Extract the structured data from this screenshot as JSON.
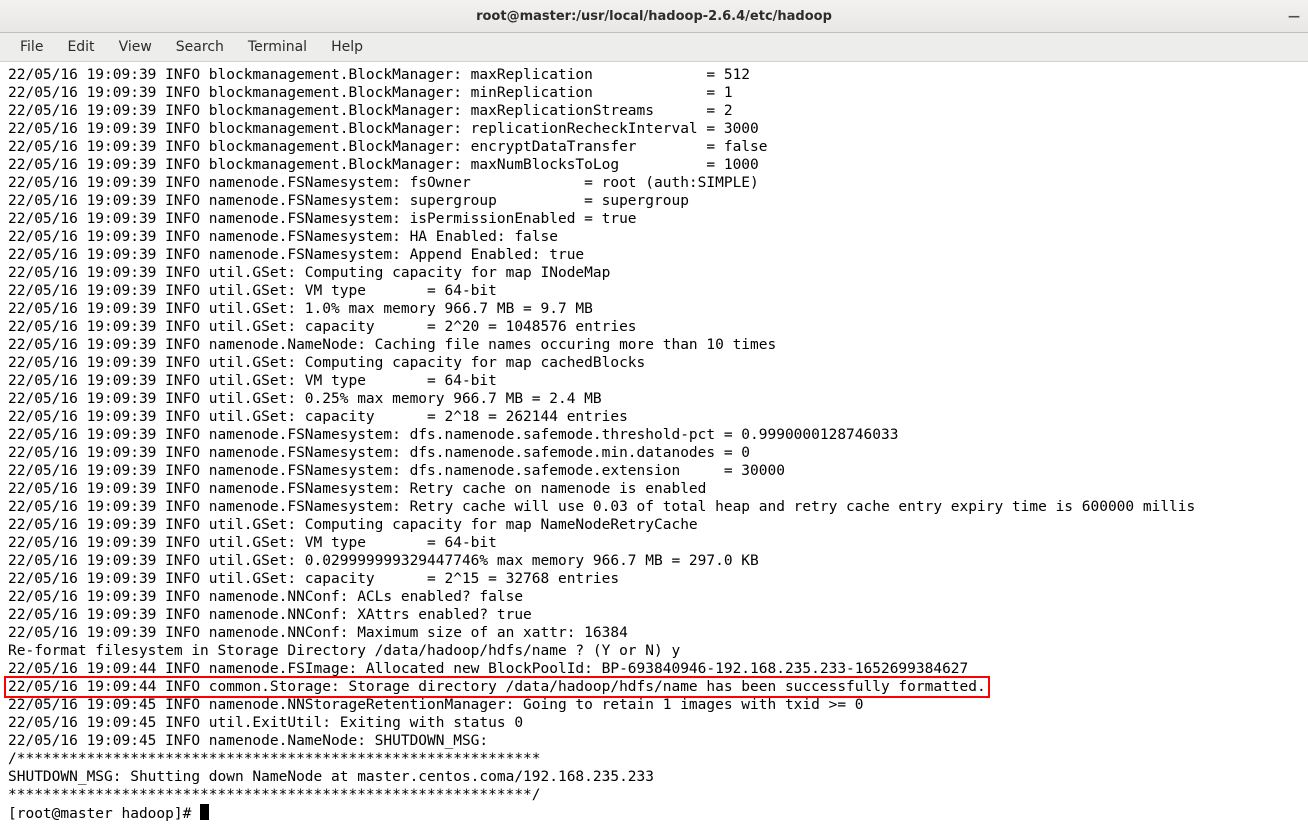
{
  "window": {
    "title": "root@master:/usr/local/hadoop-2.6.4/etc/hadoop"
  },
  "menubar": {
    "items": [
      "File",
      "Edit",
      "View",
      "Search",
      "Terminal",
      "Help"
    ]
  },
  "terminal": {
    "lines": [
      "22/05/16 19:09:39 INFO blockmanagement.BlockManager: maxReplication             = 512",
      "22/05/16 19:09:39 INFO blockmanagement.BlockManager: minReplication             = 1",
      "22/05/16 19:09:39 INFO blockmanagement.BlockManager: maxReplicationStreams      = 2",
      "22/05/16 19:09:39 INFO blockmanagement.BlockManager: replicationRecheckInterval = 3000",
      "22/05/16 19:09:39 INFO blockmanagement.BlockManager: encryptDataTransfer        = false",
      "22/05/16 19:09:39 INFO blockmanagement.BlockManager: maxNumBlocksToLog          = 1000",
      "22/05/16 19:09:39 INFO namenode.FSNamesystem: fsOwner             = root (auth:SIMPLE)",
      "22/05/16 19:09:39 INFO namenode.FSNamesystem: supergroup          = supergroup",
      "22/05/16 19:09:39 INFO namenode.FSNamesystem: isPermissionEnabled = true",
      "22/05/16 19:09:39 INFO namenode.FSNamesystem: HA Enabled: false",
      "22/05/16 19:09:39 INFO namenode.FSNamesystem: Append Enabled: true",
      "22/05/16 19:09:39 INFO util.GSet: Computing capacity for map INodeMap",
      "22/05/16 19:09:39 INFO util.GSet: VM type       = 64-bit",
      "22/05/16 19:09:39 INFO util.GSet: 1.0% max memory 966.7 MB = 9.7 MB",
      "22/05/16 19:09:39 INFO util.GSet: capacity      = 2^20 = 1048576 entries",
      "22/05/16 19:09:39 INFO namenode.NameNode: Caching file names occuring more than 10 times",
      "22/05/16 19:09:39 INFO util.GSet: Computing capacity for map cachedBlocks",
      "22/05/16 19:09:39 INFO util.GSet: VM type       = 64-bit",
      "22/05/16 19:09:39 INFO util.GSet: 0.25% max memory 966.7 MB = 2.4 MB",
      "22/05/16 19:09:39 INFO util.GSet: capacity      = 2^18 = 262144 entries",
      "22/05/16 19:09:39 INFO namenode.FSNamesystem: dfs.namenode.safemode.threshold-pct = 0.9990000128746033",
      "22/05/16 19:09:39 INFO namenode.FSNamesystem: dfs.namenode.safemode.min.datanodes = 0",
      "22/05/16 19:09:39 INFO namenode.FSNamesystem: dfs.namenode.safemode.extension     = 30000",
      "22/05/16 19:09:39 INFO namenode.FSNamesystem: Retry cache on namenode is enabled",
      "22/05/16 19:09:39 INFO namenode.FSNamesystem: Retry cache will use 0.03 of total heap and retry cache entry expiry time is 600000 millis",
      "22/05/16 19:09:39 INFO util.GSet: Computing capacity for map NameNodeRetryCache",
      "22/05/16 19:09:39 INFO util.GSet: VM type       = 64-bit",
      "22/05/16 19:09:39 INFO util.GSet: 0.029999999329447746% max memory 966.7 MB = 297.0 KB",
      "22/05/16 19:09:39 INFO util.GSet: capacity      = 2^15 = 32768 entries",
      "22/05/16 19:09:39 INFO namenode.NNConf: ACLs enabled? false",
      "22/05/16 19:09:39 INFO namenode.NNConf: XAttrs enabled? true",
      "22/05/16 19:09:39 INFO namenode.NNConf: Maximum size of an xattr: 16384",
      "Re-format filesystem in Storage Directory /data/hadoop/hdfs/name ? (Y or N) y",
      "22/05/16 19:09:44 INFO namenode.FSImage: Allocated new BlockPoolId: BP-693840946-192.168.235.233-1652699384627"
    ],
    "highlight_line": "22/05/16 19:09:44 INFO common.Storage: Storage directory /data/hadoop/hdfs/name has been successfully formatted.",
    "lines_after": [
      "22/05/16 19:09:45 INFO namenode.NNStorageRetentionManager: Going to retain 1 images with txid >= 0",
      "22/05/16 19:09:45 INFO util.ExitUtil: Exiting with status 0",
      "22/05/16 19:09:45 INFO namenode.NameNode: SHUTDOWN_MSG:",
      "/************************************************************",
      "SHUTDOWN_MSG: Shutting down NameNode at master.centos.coma/192.168.235.233",
      "************************************************************/"
    ],
    "prompt": "[root@master hadoop]# "
  }
}
